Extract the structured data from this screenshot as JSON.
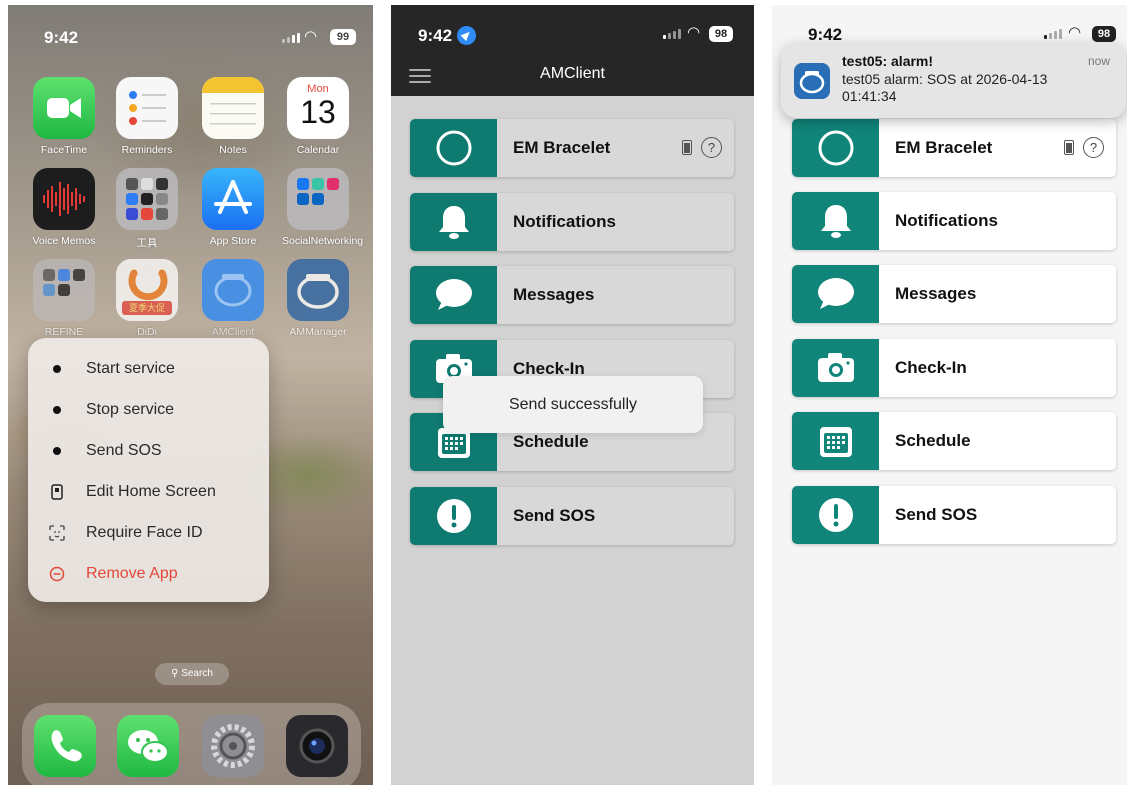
{
  "home": {
    "time": "9:42",
    "battery": "99",
    "apps": [
      {
        "label": "FaceTime"
      },
      {
        "label": "Reminders"
      },
      {
        "label": "Notes"
      },
      {
        "label": "Calendar",
        "day": "Mon",
        "date": "13"
      },
      {
        "label": "Voice Memos"
      },
      {
        "label": "工具"
      },
      {
        "label": "App Store"
      },
      {
        "label": "SocialNetworking"
      },
      {
        "label": "REFINE"
      },
      {
        "label": "DiDi",
        "badge": "夏季大促"
      },
      {
        "label": "AMClient"
      },
      {
        "label": "AMManager"
      }
    ],
    "context_menu": [
      {
        "label": "Start service"
      },
      {
        "label": "Stop service"
      },
      {
        "label": "Send SOS"
      },
      {
        "label": "Edit Home Screen"
      },
      {
        "label": "Require Face ID"
      },
      {
        "label": "Remove App"
      }
    ],
    "search": "Search"
  },
  "client": {
    "time": "9:42",
    "battery": "98",
    "title": "AMClient",
    "items": [
      {
        "label": "EM Bracelet"
      },
      {
        "label": "Notifications"
      },
      {
        "label": "Messages"
      },
      {
        "label": "Check-In"
      },
      {
        "label": "Schedule"
      },
      {
        "label": "Send SOS"
      }
    ],
    "help": "?",
    "toast": "Send successfully"
  },
  "notified": {
    "time": "9:42",
    "battery": "98",
    "notification": {
      "title": "test05: alarm!",
      "body": "test05 alarm: SOS at 2026-04-13 01:41:34",
      "time": "now"
    },
    "items": [
      {
        "label": "EM Bracelet"
      },
      {
        "label": "Notifications"
      },
      {
        "label": "Messages"
      },
      {
        "label": "Check-In"
      },
      {
        "label": "Schedule"
      },
      {
        "label": "Send SOS"
      }
    ],
    "help": "?"
  }
}
